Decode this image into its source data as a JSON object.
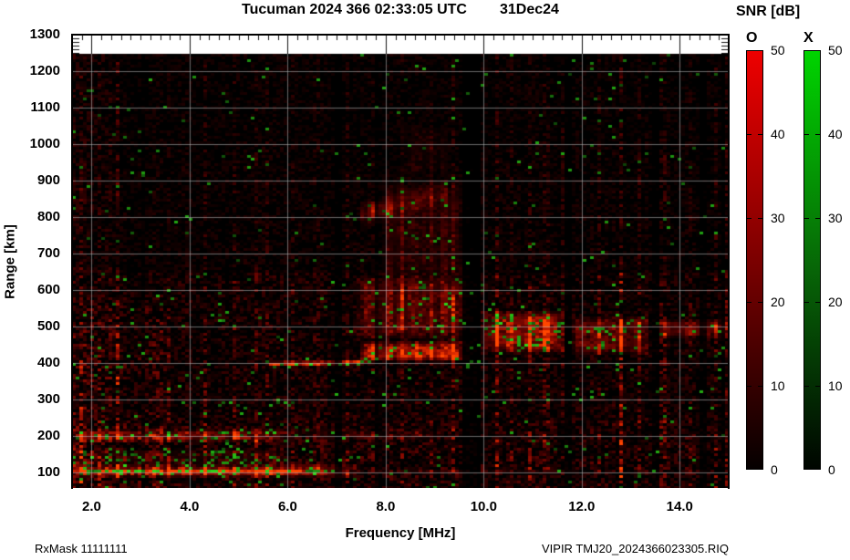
{
  "title": {
    "main": "Tucuman 2024 366 02:33:05 UTC",
    "date": "31Dec24"
  },
  "footer": {
    "left": "RxMask 11111111",
    "right": "VIPIR  TMJ20_2024366023305.RIQ"
  },
  "axes": {
    "x": {
      "label": "Frequency [MHz]",
      "tick_labels": [
        "2.0",
        "4.0",
        "6.0",
        "8.0",
        "10.0",
        "12.0",
        "14.0"
      ],
      "tick_values": [
        2,
        4,
        6,
        8,
        10,
        12,
        14
      ],
      "minor_step": 0.2
    },
    "y": {
      "label": "Range [km]",
      "tick_labels": [
        "1300",
        "1200",
        "1100",
        "1000",
        "900",
        "800",
        "700",
        "600",
        "500",
        "400",
        "300",
        "200",
        "100"
      ],
      "tick_values": [
        1300,
        1200,
        1100,
        1000,
        900,
        800,
        700,
        600,
        500,
        400,
        300,
        200,
        100
      ],
      "grid_values": [
        1200,
        1100,
        1000,
        900,
        800,
        700,
        600,
        500,
        400,
        300,
        200,
        100
      ]
    }
  },
  "colorbar": {
    "title": "SNR [dB]",
    "min": 0,
    "max": 50,
    "tick_labels": [
      "50",
      "40",
      "30",
      "20",
      "10",
      "0"
    ],
    "tick_values": [
      50,
      40,
      30,
      20,
      10,
      0
    ],
    "dash_values": [
      40,
      30,
      20,
      10
    ],
    "bars": [
      {
        "label": "O",
        "top_color": "#ee0000",
        "mid_color": "#770000",
        "bottom_color": "#050000"
      },
      {
        "label": "X",
        "top_color": "#00d400",
        "mid_color": "#076607",
        "bottom_color": "#000500"
      }
    ]
  },
  "chart_data": {
    "type": "heatmap",
    "title": "Tucuman VIPIR ionogram 2024 day 366 02:33:05 UTC",
    "xlabel": "Frequency [MHz]",
    "ylabel": "Range [km]",
    "x_range": [
      1.6,
      15.0
    ],
    "y_range": [
      57,
      1300
    ],
    "data_max_range": 1248,
    "grid": true,
    "snr_scale_db": [
      0,
      50
    ],
    "polarization_colors": {
      "O": "#ee0000",
      "X": "#00cc00"
    },
    "grid_color": "#9a9a9a",
    "noise": {
      "low": 0.2,
      "mid": 0.15,
      "upper": 0.085,
      "high": 0.072,
      "green_base": 0.012
    },
    "rfi": {
      "dark": [
        [
          6.95,
          7.08
        ],
        [
          9.6,
          9.97
        ],
        [
          11.63,
          11.78
        ],
        [
          13.4,
          13.55
        ],
        [
          14.38,
          14.52
        ]
      ],
      "bright": [
        1.75,
        2.12,
        2.5,
        3.02,
        3.55,
        4.25,
        4.85,
        5.35,
        6.2,
        6.55,
        7.18,
        7.72,
        8.3,
        8.62,
        8.88,
        9.35,
        10.25,
        10.55,
        10.9,
        11.3,
        12.35,
        12.8,
        13.15,
        14.2,
        14.72
      ]
    },
    "features": [
      {
        "type": "band",
        "name": "E-layer echo outer",
        "f": [
          1.6,
          7.6
        ],
        "r": [
          86,
          122
        ],
        "amp": 0.5,
        "fade_out": 1.0,
        "green": 0.08
      },
      {
        "type": "band",
        "name": "E-layer echo core",
        "f": [
          1.6,
          7.0
        ],
        "r": [
          95,
          110
        ],
        "amp": 1.1,
        "fade_out": 1.2,
        "green": 0.12
      },
      {
        "type": "band",
        "name": "E X-mode green line",
        "f": [
          2.4,
          4.7
        ],
        "r": [
          96,
          106
        ],
        "amp": 0,
        "green": 0.85,
        "green_bright": true,
        "fade_out": 0.3
      },
      {
        "type": "band",
        "name": "E upper scatter",
        "f": [
          1.6,
          6.0
        ],
        "r": [
          118,
          165
        ],
        "amp": 0.1,
        "green": 0.18
      },
      {
        "type": "band",
        "name": "Es 200 km band",
        "f": [
          1.6,
          6.3
        ],
        "r": [
          182,
          218
        ],
        "amp": 0.42,
        "fade_out": 1.2,
        "green": 0.12
      },
      {
        "type": "band",
        "name": "Es 200 km tail",
        "f": [
          6.3,
          9.2
        ],
        "r": [
          185,
          215
        ],
        "amp": 0.1,
        "green": 0.03
      },
      {
        "type": "band",
        "name": "E 100 km tail",
        "f": [
          7.6,
          12.0
        ],
        "r": [
          94,
          112
        ],
        "amp": 0.12,
        "green": 0.02
      },
      {
        "type": "trace",
        "name": "F trace leading edge",
        "pts": [
          [
            5.6,
            396
          ],
          [
            6.4,
            399
          ],
          [
            7.0,
            401
          ],
          [
            7.6,
            405
          ]
        ],
        "thick": 16,
        "amp": 0.8,
        "green_edge": 0.3
      },
      {
        "type": "band",
        "name": "F main echo blob",
        "f": [
          7.5,
          9.65
        ],
        "r": [
          404,
          462
        ],
        "amp": 0.95,
        "bottom": true,
        "green": 0.1,
        "fade_in": 0.1,
        "fade_out": 0.25
      },
      {
        "type": "band",
        "name": "spread F low",
        "f": [
          7.4,
          9.7
        ],
        "r": [
          462,
          640
        ],
        "amp": 0.26,
        "green": 0.05,
        "streaky": true,
        "r_fade": 30
      },
      {
        "type": "band",
        "name": "spread F high",
        "f": [
          7.9,
          9.6
        ],
        "r": [
          620,
          900
        ],
        "amp": 0.11,
        "green": 0.02,
        "streaky": true,
        "r_fade": 40
      },
      {
        "type": "band",
        "name": "spread F very high",
        "f": [
          8.3,
          9.3
        ],
        "r": [
          900,
          1060
        ],
        "amp": 0.05,
        "green": 0.01,
        "streaky": true,
        "r_fade": 40
      },
      {
        "type": "band",
        "name": "patch 10.0-11.7 MHz",
        "f": [
          9.95,
          11.65
        ],
        "r": [
          425,
          545
        ],
        "amp": 0.55,
        "green": 0.17,
        "r_fade": 25,
        "fade_in": 0.2,
        "fade_out": 0.15
      },
      {
        "type": "band",
        "name": "patch 11.8-13.4 MHz",
        "f": [
          11.8,
          13.4
        ],
        "r": [
          418,
          530
        ],
        "amp": 0.35,
        "green": 0.07,
        "r_fade": 22
      },
      {
        "type": "band",
        "name": "wedge 13.5-15 MHz",
        "f": [
          13.55,
          15.0
        ],
        "r": [
          468,
          522
        ],
        "amp": 0.33,
        "green": 0.05,
        "fade_out": 0.05,
        "r_fade": 15
      },
      {
        "type": "trace",
        "name": "second hop echo",
        "pts": [
          [
            7.5,
            805
          ],
          [
            8.4,
            835
          ],
          [
            9.3,
            870
          ]
        ],
        "thick": 80,
        "amp": 0.17,
        "green": 0.03
      },
      {
        "type": "band",
        "name": "second hop core",
        "f": [
          7.55,
          8.25
        ],
        "r": [
          795,
          845
        ],
        "amp": 0.3,
        "green": 0.04
      }
    ]
  }
}
